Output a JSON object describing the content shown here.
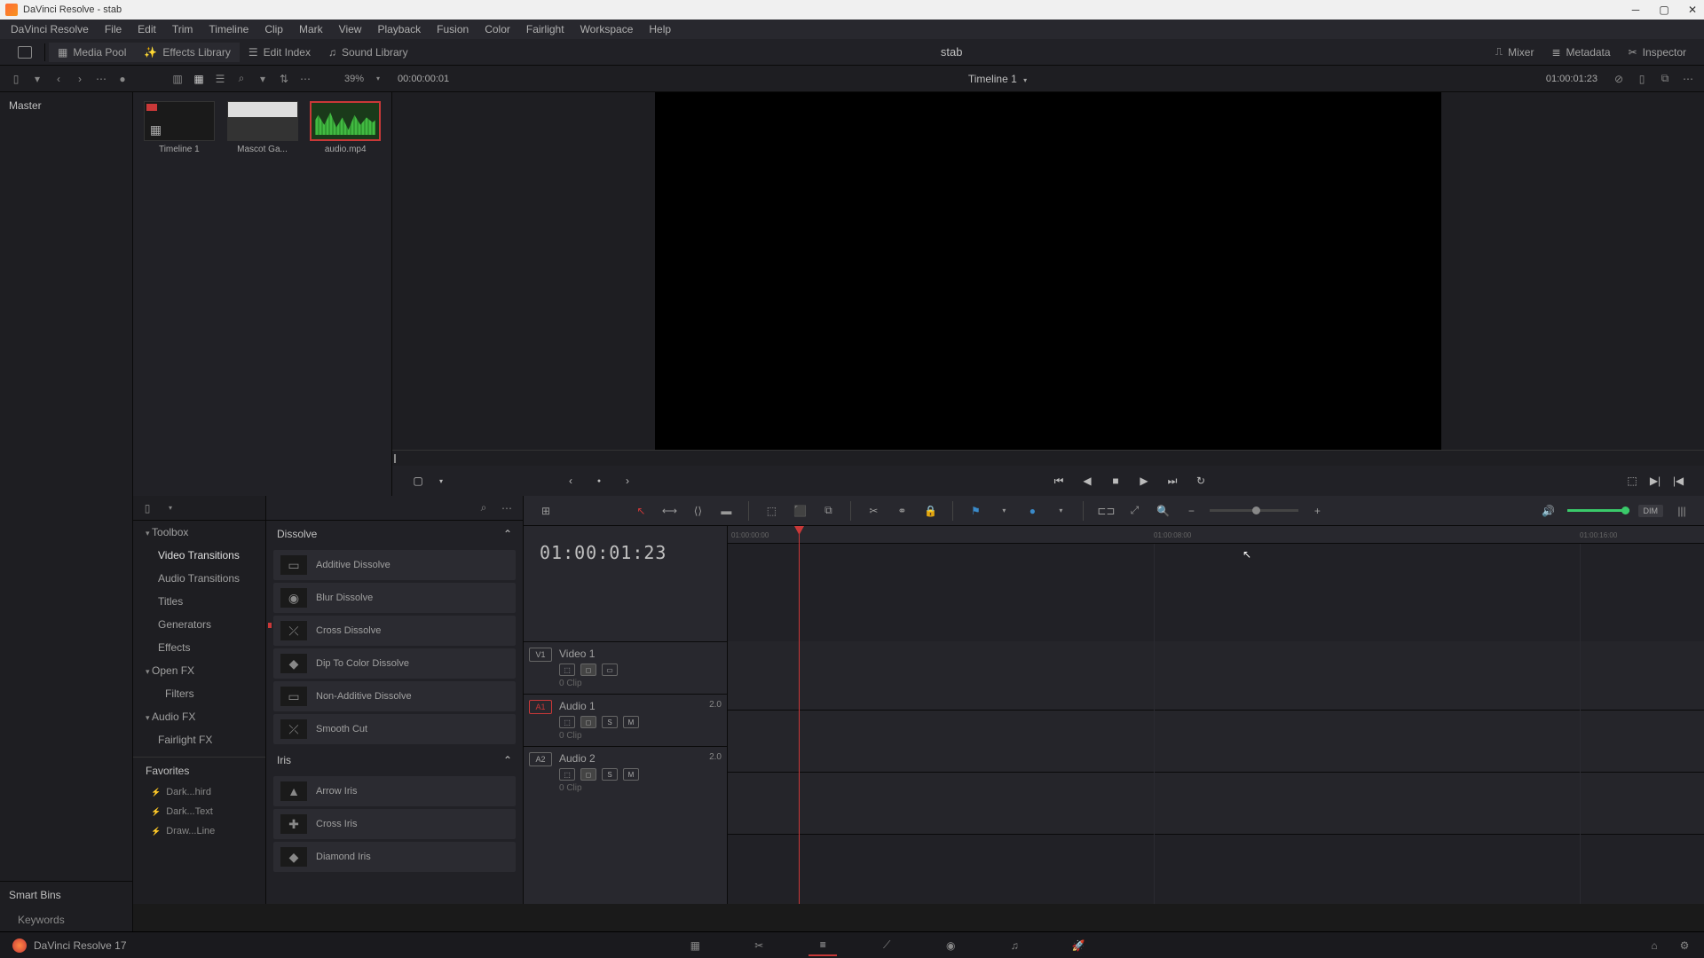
{
  "window": {
    "title": "DaVinci Resolve - stab"
  },
  "menubar": [
    "DaVinci Resolve",
    "File",
    "Edit",
    "Trim",
    "Timeline",
    "Clip",
    "Mark",
    "View",
    "Playback",
    "Fusion",
    "Color",
    "Fairlight",
    "Workspace",
    "Help"
  ],
  "top_toolbar": {
    "media_pool": "Media Pool",
    "effects_library": "Effects Library",
    "edit_index": "Edit Index",
    "sound_library": "Sound Library",
    "project_title": "stab",
    "mixer": "Mixer",
    "metadata": "Metadata",
    "inspector": "Inspector"
  },
  "sec_toolbar": {
    "zoom": "39%",
    "source_tc": "00:00:00:01",
    "timeline_name": "Timeline 1",
    "record_tc": "01:00:01:23"
  },
  "bin_tree": {
    "master": "Master",
    "smart_bins": "Smart Bins",
    "keywords": "Keywords"
  },
  "clips": [
    {
      "name": "Timeline 1"
    },
    {
      "name": "Mascot Ga..."
    },
    {
      "name": "audio.mp4"
    }
  ],
  "fx_sidebar": {
    "toolbox": "Toolbox",
    "video_transitions": "Video Transitions",
    "audio_transitions": "Audio Transitions",
    "titles": "Titles",
    "generators": "Generators",
    "effects": "Effects",
    "open_fx": "Open FX",
    "filters": "Filters",
    "audio_fx": "Audio FX",
    "fairlight_fx": "Fairlight FX",
    "favorites": "Favorites",
    "fav_items": [
      "Dark...hird",
      "Dark...Text",
      "Draw...Line"
    ]
  },
  "fx_list": {
    "dissolve_header": "Dissolve",
    "dissolve_items": [
      "Additive Dissolve",
      "Blur Dissolve",
      "Cross Dissolve",
      "Dip To Color Dissolve",
      "Non-Additive Dissolve",
      "Smooth Cut"
    ],
    "iris_header": "Iris",
    "iris_items": [
      "Arrow Iris",
      "Cross Iris",
      "Diamond Iris"
    ]
  },
  "timeline": {
    "big_tc": "01:00:01:23",
    "tracks": [
      {
        "dest": "V1",
        "name": "Video 1",
        "clips": "0 Clip",
        "ch": ""
      },
      {
        "dest": "A1",
        "name": "Audio 1",
        "clips": "0 Clip",
        "ch": "2.0"
      },
      {
        "dest": "A2",
        "name": "Audio 2",
        "clips": "0 Clip",
        "ch": "2.0"
      }
    ],
    "ruler": [
      "01:00:00:00",
      "01:00:08:00",
      "01:00:16:00"
    ],
    "dim": "DIM"
  },
  "bottom": {
    "version": "DaVinci Resolve 17"
  }
}
